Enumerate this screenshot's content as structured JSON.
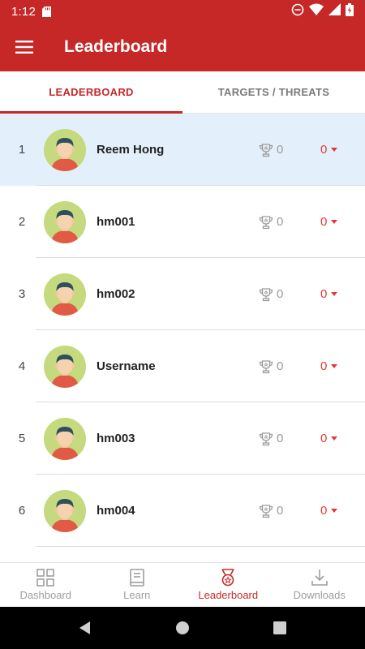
{
  "status_bar": {
    "time": "1:12"
  },
  "app_bar": {
    "title": "Leaderboard",
    "menu_icon": "hamburger-menu-icon"
  },
  "tabs": [
    {
      "label": "LEADERBOARD",
      "active": true
    },
    {
      "label": "TARGETS / THREATS",
      "active": false
    }
  ],
  "leaderboard": [
    {
      "rank": "1",
      "name": "Reem Hong",
      "score": "0",
      "change": "0",
      "highlighted": true
    },
    {
      "rank": "2",
      "name": "hm001",
      "score": "0",
      "change": "0",
      "highlighted": false
    },
    {
      "rank": "3",
      "name": "hm002",
      "score": "0",
      "change": "0",
      "highlighted": false
    },
    {
      "rank": "4",
      "name": "Username",
      "score": "0",
      "change": "0",
      "highlighted": false
    },
    {
      "rank": "5",
      "name": "hm003",
      "score": "0",
      "change": "0",
      "highlighted": false
    },
    {
      "rank": "6",
      "name": "hm004",
      "score": "0",
      "change": "0",
      "highlighted": false
    }
  ],
  "bottom_nav": [
    {
      "label": "Dashboard",
      "icon": "dashboard-grid-icon",
      "active": false
    },
    {
      "label": "Learn",
      "icon": "book-icon",
      "active": false
    },
    {
      "label": "Leaderboard",
      "icon": "medal-icon",
      "active": true
    },
    {
      "label": "Downloads",
      "icon": "download-icon",
      "active": false
    }
  ],
  "colors": {
    "primary": "#c62828",
    "highlight_row": "#e3f0fb",
    "avatar_bg": "#c5d97e",
    "change_red": "#e53935",
    "muted": "#9e9e9e"
  }
}
